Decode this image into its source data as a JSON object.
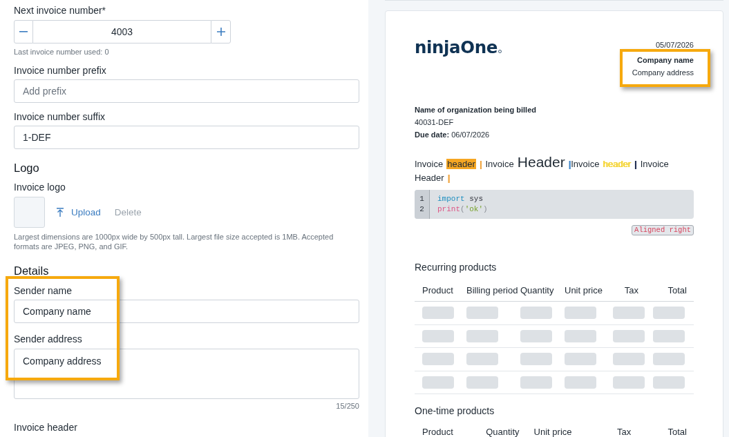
{
  "form": {
    "next_invoice_number": {
      "label": "Next invoice number*",
      "value": "4003",
      "hint": "Last invoice number used: 0"
    },
    "prefix": {
      "label": "Invoice number prefix",
      "placeholder": "Add prefix"
    },
    "suffix": {
      "label": "Invoice number suffix",
      "value": "1-DEF"
    },
    "logo_section": {
      "heading": "Logo",
      "label": "Invoice logo",
      "actions": [
        {
          "kind": "upload",
          "label": "Upload",
          "disabled": false
        },
        {
          "kind": "delete",
          "label": "Delete",
          "disabled": true
        }
      ],
      "help": "Largest dimensions are 1000px wide by 500px tall. Largest file size accepted is 1MB. Accepted formats are JPEG, PNG, and GIF."
    },
    "details_section": {
      "heading": "Details",
      "highlighted": true,
      "sender_name": {
        "label": "Sender name",
        "value": "Company name"
      },
      "sender_address": {
        "label": "Sender address",
        "value": "Company address",
        "counter": "15/250"
      }
    },
    "invoice_header": {
      "label": "Invoice header"
    }
  },
  "preview": {
    "logo": "ninjaOne",
    "date": "05/07/2026",
    "sender": {
      "highlighted": true,
      "name": "Company name",
      "address": "Company address"
    },
    "billing": {
      "organization": "Name of organization being billed",
      "invoice_number": "40031-DEF",
      "due_date": "**Due date:** 06/07/2026"
    },
    "header_runs": [
      {
        "text": "Invoice",
        "kind": "plain"
      },
      {
        "text": "header",
        "kind": "highlight",
        "color": "#f5a623"
      },
      {
        "text": "|",
        "kind": "colored",
        "color": "#f0a540"
      },
      {
        "text": "Invoice",
        "kind": "plain"
      },
      {
        "text": "Header",
        "kind": "large"
      },
      {
        "text": "|",
        "kind": "colored",
        "color": "#3f86c8",
        "tight": true
      },
      {
        "text": "Invoice",
        "kind": "plain"
      },
      {
        "text": "header",
        "kind": "colored",
        "color": "#f5d63d"
      },
      {
        "text": "|",
        "kind": "colored",
        "color": "#1d2b4f"
      },
      {
        "text": "Invoice Header",
        "kind": "plain"
      },
      {
        "text": "|",
        "kind": "colored",
        "color": "#f0a540"
      }
    ],
    "code_block": {
      "lines": [
        {
          "number": "1",
          "tokens": [
            {
              "text": "import",
              "kind": "keyword"
            },
            {
              "text": "sys",
              "kind": "plain",
              "gap": true
            }
          ]
        },
        {
          "number": "2",
          "tokens": [
            {
              "text": "print",
              "kind": "function"
            },
            {
              "text": "(",
              "kind": "punctuation"
            },
            {
              "text": "'ok'",
              "kind": "string"
            },
            {
              "text": ")",
              "kind": "punctuation"
            }
          ]
        }
      ]
    },
    "badge": "Aligned right",
    "recurring_products": {
      "title": "Recurring products",
      "columns": [
        "Product",
        "Billing period",
        "Quantity",
        "Unit price",
        "Tax",
        "Total"
      ],
      "rows": [
        {
          "loading": true
        },
        {
          "loading": true
        },
        {
          "loading": true
        },
        {
          "loading": true
        }
      ]
    },
    "one_time_products": {
      "title": "One-time products",
      "columns": [
        "Product",
        "Quantity",
        "Unit price",
        "Tax",
        "Total"
      ]
    }
  }
}
